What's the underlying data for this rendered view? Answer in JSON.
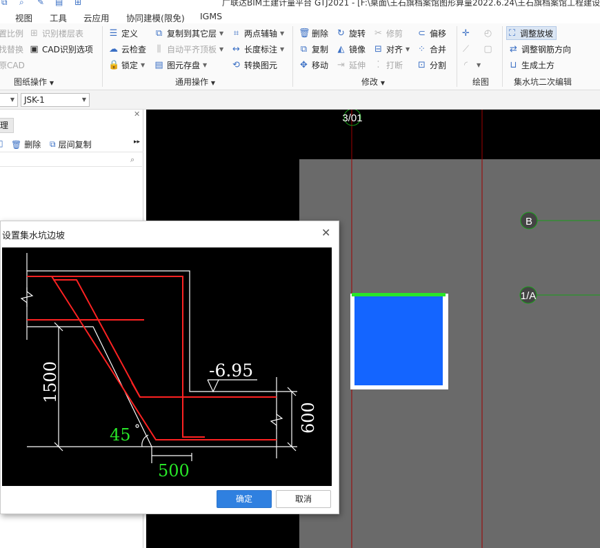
{
  "window": {
    "title": "广联达BIM土建计量平台 GTJ2021 - [F:\\桌面\\王石旗档案馆图形算量2022.6.24\\王石旗档案馆工程建设"
  },
  "menu": [
    "视图",
    "工具",
    "云应用",
    "协同建模(限免)",
    "IGMS"
  ],
  "ribbon": {
    "left_partial": [
      {
        "label": "置比例",
        "enabled": false
      },
      {
        "label": "识别楼层表",
        "enabled": false
      },
      {
        "label": "找替换",
        "enabled": false
      },
      {
        "label": "CAD识别选项",
        "enabled": true
      },
      {
        "label": "原CAD",
        "enabled": false
      }
    ],
    "general_ops": [
      {
        "label": "定义",
        "icon": "define-icon"
      },
      {
        "label": "复制到其它层",
        "icon": "copy-floor-icon"
      },
      {
        "label": "两点辅轴",
        "icon": "axis-icon"
      },
      {
        "label": "云检查",
        "icon": "cloud-check-icon"
      },
      {
        "label": "自动平齐顶板",
        "icon": "align-top-icon"
      },
      {
        "label": "长度标注",
        "icon": "dimension-icon"
      },
      {
        "label": "锁定",
        "icon": "lock-icon"
      },
      {
        "label": "图元存盘",
        "icon": "save-element-icon"
      },
      {
        "label": "转换图元",
        "icon": "convert-icon"
      }
    ],
    "modify": [
      {
        "label": "删除",
        "icon": "delete-icon"
      },
      {
        "label": "旋转",
        "icon": "rotate-icon"
      },
      {
        "label": "修剪",
        "icon": "trim-icon"
      },
      {
        "label": "偏移",
        "icon": "offset-icon"
      },
      {
        "label": "复制",
        "icon": "copy-icon"
      },
      {
        "label": "镜像",
        "icon": "mirror-icon"
      },
      {
        "label": "对齐",
        "icon": "align-icon"
      },
      {
        "label": "合并",
        "icon": "merge-icon"
      },
      {
        "label": "移动",
        "icon": "move-icon"
      },
      {
        "label": "延伸",
        "icon": "extend-icon"
      },
      {
        "label": "打断",
        "icon": "break-icon"
      },
      {
        "label": "分割",
        "icon": "split-icon"
      }
    ],
    "pit": [
      {
        "label": "调整放坡",
        "icon": "slope-icon"
      },
      {
        "label": "调整钢筋方向",
        "icon": "rebar-direction-icon"
      },
      {
        "label": "生成土方",
        "icon": "earthwork-icon"
      }
    ],
    "groups": {
      "drawing_ops": "图纸操作",
      "general_ops": "通用操作",
      "modify": "修改",
      "draw": "绘图",
      "pit_edit": "集水坑二次编辑"
    }
  },
  "selector": {
    "component": "JSK-1"
  },
  "left_panel": {
    "tab": "理",
    "tools": [
      "删除",
      "层间复制"
    ]
  },
  "canvas": {
    "axes": [
      "3/01",
      "B",
      "1/A"
    ],
    "colors": {
      "background": "#000000",
      "slab": "#6a6a6a",
      "pit": "#1465ff",
      "pit_edge": "#28e628",
      "axis_line": "#a00000",
      "grid_line": "#18a018"
    }
  },
  "dialog": {
    "title": "设置集水坑边坡",
    "figure": {
      "elevation": "-6.95",
      "depth": "1500",
      "slab": "600",
      "angle": "45",
      "offset": "500"
    },
    "ok": "确定",
    "cancel": "取消"
  }
}
